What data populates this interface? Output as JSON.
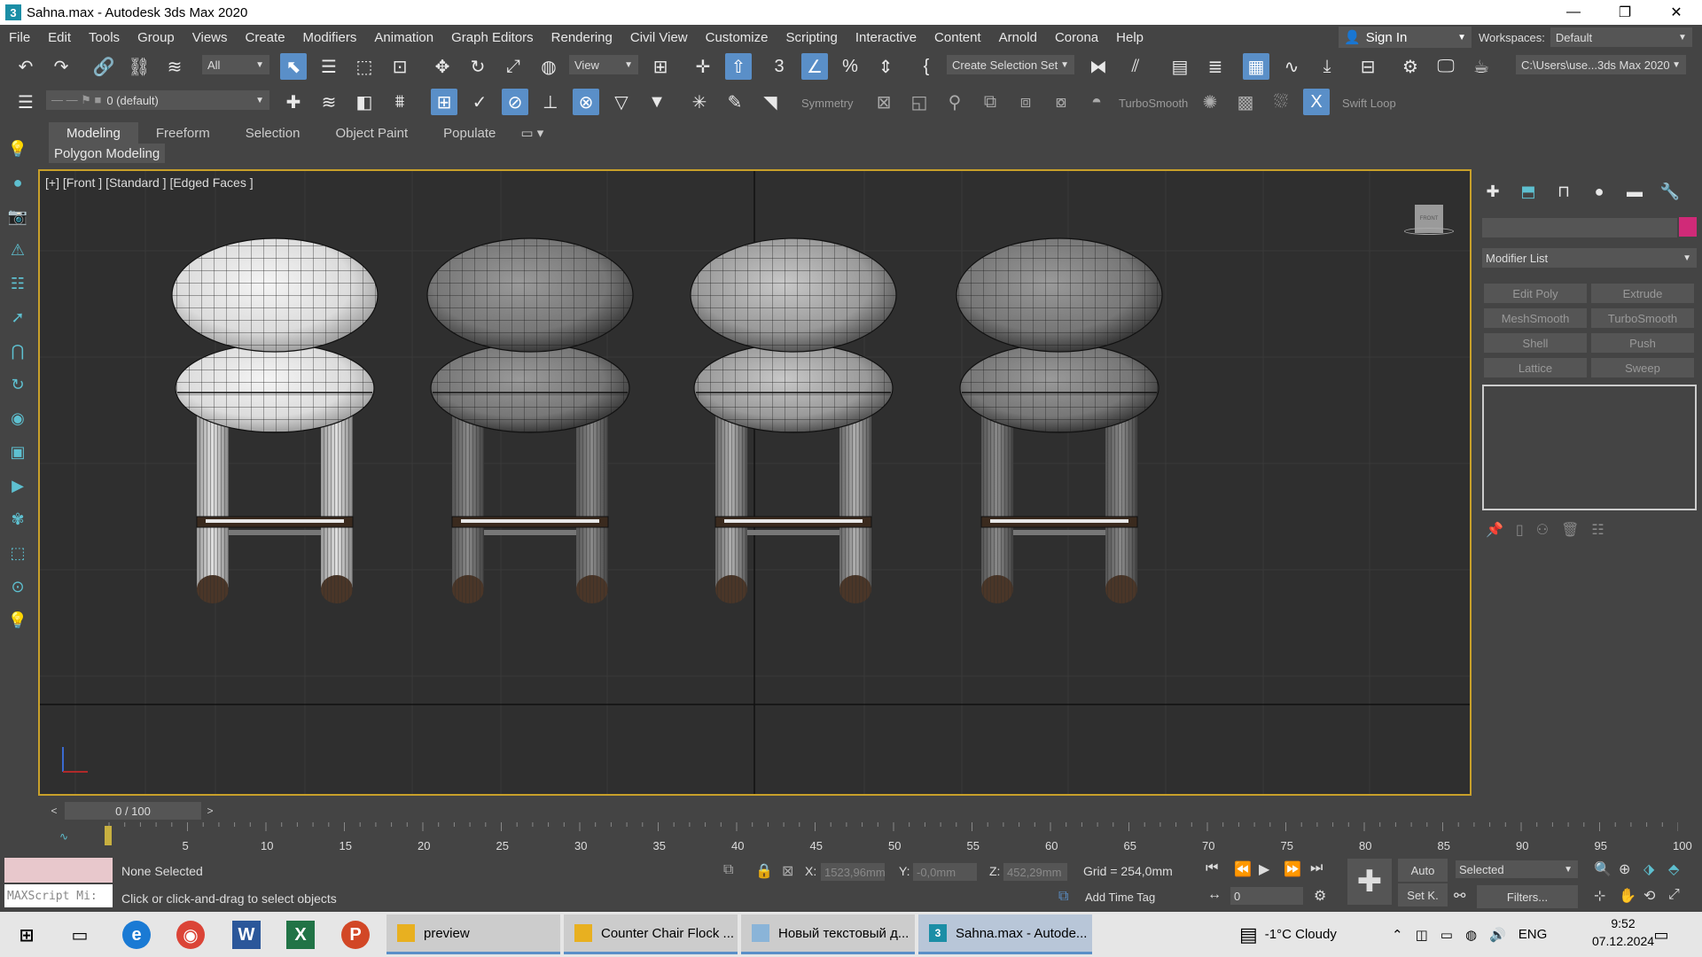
{
  "window": {
    "title": "Sahna.max - Autodesk 3ds Max 2020",
    "app_icon_letter": "3",
    "minimize": "—",
    "restore": "❐",
    "close": "✕"
  },
  "menu": [
    "File",
    "Edit",
    "Tools",
    "Group",
    "Views",
    "Create",
    "Modifiers",
    "Animation",
    "Graph Editors",
    "Rendering",
    "Civil View",
    "Customize",
    "Scripting",
    "Interactive",
    "Content",
    "Arnold",
    "Corona",
    "Help"
  ],
  "account": {
    "sign_in": "Sign In",
    "workspaces_label": "Workspaces:",
    "workspace": "Default"
  },
  "toolbar": {
    "selection_filter": "All",
    "ref_coord": "View",
    "named_selection": "Create Selection Set",
    "project_path": "C:\\Users\\use...3ds Max 2020",
    "layer": "0 (default)",
    "symmetry": "Symmetry",
    "turbosmooth": "TurboSmooth",
    "swift_loop": "Swift Loop"
  },
  "ribbon": {
    "tabs": [
      "Modeling",
      "Freeform",
      "Selection",
      "Object Paint",
      "Populate"
    ],
    "active_tab": "Modeling",
    "sub_label": "Polygon Modeling"
  },
  "viewport": {
    "label": "[+] [Front ] [Standard ] [Edged Faces ]",
    "viewcube_label": "FRONT",
    "objects": [
      "chair-1",
      "chair-2",
      "chair-3",
      "chair-4"
    ]
  },
  "command_panel": {
    "modifier_list": "Modifier List",
    "buttons": [
      "Edit Poly",
      "Extrude",
      "MeshSmooth",
      "TurboSmooth",
      "Shell",
      "Push",
      "Lattice",
      "Sweep"
    ],
    "object_color": "#d02a78"
  },
  "timeline": {
    "frame_display": "0 / 100",
    "prev": "<",
    "next": ">",
    "ticks": [
      "5",
      "10",
      "15",
      "20",
      "25",
      "30",
      "35",
      "40",
      "45",
      "50",
      "55",
      "60",
      "65",
      "70",
      "75",
      "80",
      "85",
      "90",
      "95",
      "100"
    ]
  },
  "status": {
    "maxscript": "MAXScript Mi:",
    "selection": "None Selected",
    "prompt": "Click or click-and-drag to select objects",
    "x_label": "X:",
    "x_value": "1523,96mm",
    "y_label": "Y:",
    "y_value": "-0,0mm",
    "z_label": "Z:",
    "z_value": "452,29mm",
    "grid": "Grid = 254,0mm",
    "add_time_tag": "Add Time Tag",
    "auto": "Auto",
    "set_key": "Set K.",
    "key_filter_mode": "Selected",
    "filters": "Filters...",
    "frame_field": "0"
  },
  "taskbar": {
    "windows": [
      {
        "label": "preview",
        "icon": "folder"
      },
      {
        "label": "Counter Chair Flock ...",
        "icon": "folder"
      },
      {
        "label": "Новый текстовый д...",
        "icon": "notepad"
      },
      {
        "label": "Sahna.max - Autode...",
        "icon": "3dsmax"
      }
    ],
    "weather": "-1°C  Cloudy",
    "lang": "ENG",
    "time": "9:52",
    "date": "07.12.2024"
  }
}
